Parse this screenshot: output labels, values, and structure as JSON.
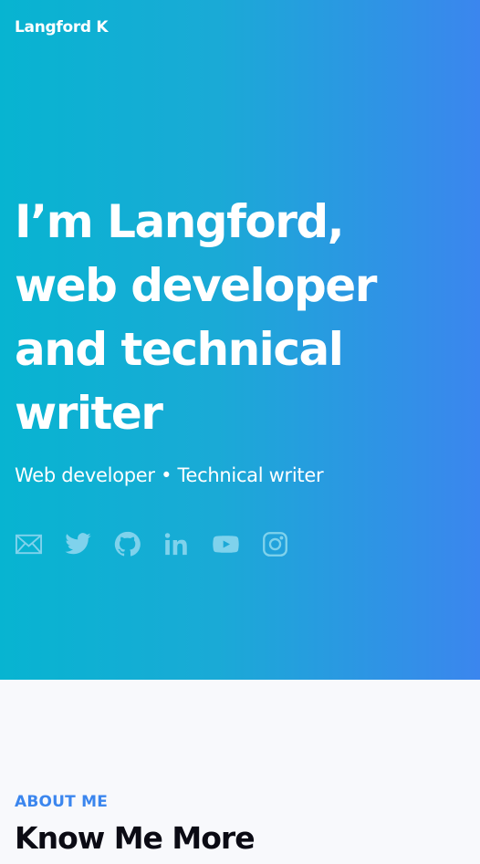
{
  "header": {
    "logo_text": "Langford K"
  },
  "hero": {
    "headline_lines": [
      "I’m Langford,",
      "web developer",
      "and technical",
      "writer"
    ],
    "subtitle": "Web developer • Technical writer",
    "social_icons": [
      "mail-icon",
      "twitter-icon",
      "github-icon",
      "linkedin-icon",
      "youtube-icon",
      "instagram-icon"
    ],
    "gradient_colors": [
      "#07b4d1",
      "#3b86ee"
    ],
    "icon_color": "#7fd2ec"
  },
  "about": {
    "kicker": "ABOUT ME",
    "title": "Know Me More",
    "accent_color": "#3b86ee"
  }
}
